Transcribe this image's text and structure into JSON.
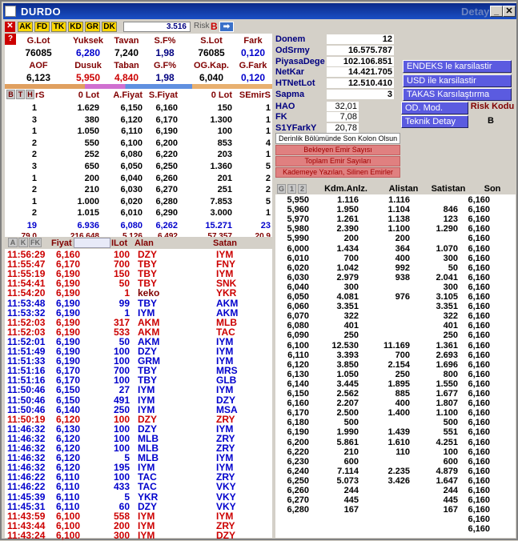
{
  "window": {
    "title": "DURDO",
    "detail": "Detay"
  },
  "toolbar": {
    "tabs": [
      "AK",
      "FD",
      "TK",
      "KD",
      "GR",
      "DK"
    ],
    "price": "3.516",
    "risk_label": "Risk",
    "risk_value": "B"
  },
  "summary": {
    "headers1": [
      "G.Lot",
      "Yuksek",
      "Tavan",
      "S.F%",
      "S.Lot",
      "Fark"
    ],
    "values1": [
      "76085",
      "6,280",
      "7,240",
      "1,98",
      "76085",
      "0,120"
    ],
    "headers2": [
      "AOF",
      "Dusuk",
      "Taban",
      "G.F%",
      "OG.Kap.",
      "G.Fark"
    ],
    "values2": [
      "6,123",
      "5,950",
      "4,840",
      "1,98",
      "6,040",
      "0,120"
    ]
  },
  "stats": [
    {
      "label": "Donem",
      "value": "12"
    },
    {
      "label": "OdSrmy",
      "value": "16.575.787"
    },
    {
      "label": "PiyasaDege",
      "value": "102.106.851"
    },
    {
      "label": "NetKar",
      "value": "14.421.705"
    },
    {
      "label": "HTNetLot",
      "value": "12.510.410"
    },
    {
      "label": "Sapma",
      "value": "3"
    }
  ],
  "stats2": [
    {
      "label": "HAO",
      "value": "32,01"
    },
    {
      "label": "FK",
      "value": "7,08"
    },
    {
      "label": "S1YFarkY",
      "value": "20,78"
    }
  ],
  "buttons": {
    "endeks": "ENDEKS le karsilastir",
    "usd": "USD ile karsilastir",
    "takas": "TAKAS Karsılaştırma",
    "od_mod": "OD. Mod.",
    "risk_kodu": "Risk Kodu",
    "teknik": "Teknik Detay",
    "risk_val": "B"
  },
  "depth_note": "Derinlik Bölümünde Son Kolon Olsun",
  "red_buttons": [
    "Bekleyen Emir Sayısı",
    "Toplam Emir Sayıları",
    "Kademeye Yazılan, Silinen Emirler"
  ],
  "depth": {
    "side_tabs": [
      "B",
      "T",
      "H"
    ],
    "headers": [
      "rS",
      "0 Lot",
      "A.Fiyat",
      "S.Fiyat",
      "0 Lot",
      "SEmirS"
    ],
    "rows": [
      [
        "1",
        "1.629",
        "6,150",
        "6,160",
        "150",
        "1"
      ],
      [
        "3",
        "380",
        "6,120",
        "6,170",
        "1.300",
        "1"
      ],
      [
        "1",
        "1.050",
        "6,110",
        "6,190",
        "100",
        "1"
      ],
      [
        "2",
        "550",
        "6,100",
        "6,200",
        "853",
        "4"
      ],
      [
        "2",
        "252",
        "6,080",
        "6,220",
        "203",
        "1"
      ],
      [
        "3",
        "650",
        "6,050",
        "6,250",
        "1.360",
        "5"
      ],
      [
        "1",
        "200",
        "6,040",
        "6,260",
        "201",
        "2"
      ],
      [
        "2",
        "210",
        "6,030",
        "6,270",
        "251",
        "2"
      ],
      [
        "1",
        "1.000",
        "6,020",
        "6,280",
        "7.853",
        "5"
      ],
      [
        "2",
        "1.015",
        "6,010",
        "6,290",
        "3.000",
        "1"
      ]
    ],
    "totals": [
      "19",
      "6.936",
      "6,080",
      "6,262",
      "15.271",
      "23"
    ],
    "extra": [
      "79.0",
      "216.648",
      "5.126",
      "6.492",
      "57.357",
      "20.9"
    ]
  },
  "trades": {
    "tabs": [
      "A",
      "K",
      "FK"
    ],
    "headers": [
      "Fiyat",
      "ILot",
      "Alan",
      "Satan"
    ],
    "rows": [
      {
        "t": "11:56:29",
        "p": "6,160",
        "l": "100",
        "a": "DZY",
        "s": "IYM",
        "c": "r"
      },
      {
        "t": "11:55:47",
        "p": "6,170",
        "l": "700",
        "a": "TBY",
        "s": "FNY",
        "c": "r"
      },
      {
        "t": "11:55:19",
        "p": "6,190",
        "l": "150",
        "a": "TBY",
        "s": "IYM",
        "c": "r"
      },
      {
        "t": "11:54:41",
        "p": "6,190",
        "l": "50",
        "a": "TBY",
        "s": "SNK",
        "c": "r"
      },
      {
        "t": "11:54:20",
        "p": "6,190",
        "l": "1",
        "a": "keko",
        "s": "YKR",
        "c": "r"
      },
      {
        "t": "11:53:48",
        "p": "6,190",
        "l": "99",
        "a": "TBY",
        "s": "AKM",
        "c": "b"
      },
      {
        "t": "11:53:32",
        "p": "6,190",
        "l": "1",
        "a": "IYM",
        "s": "AKM",
        "c": "b"
      },
      {
        "t": "11:52:03",
        "p": "6,190",
        "l": "317",
        "a": "AKM",
        "s": "MLB",
        "c": "r"
      },
      {
        "t": "11:52:03",
        "p": "6,190",
        "l": "533",
        "a": "AKM",
        "s": "TAC",
        "c": "r"
      },
      {
        "t": "11:52:01",
        "p": "6,190",
        "l": "50",
        "a": "AKM",
        "s": "IYM",
        "c": "b"
      },
      {
        "t": "11:51:49",
        "p": "6,190",
        "l": "100",
        "a": "DZY",
        "s": "IYM",
        "c": "b"
      },
      {
        "t": "11:51:33",
        "p": "6,190",
        "l": "100",
        "a": "GRM",
        "s": "IYM",
        "c": "b"
      },
      {
        "t": "11:51:16",
        "p": "6,170",
        "l": "700",
        "a": "TBY",
        "s": "MRS",
        "c": "b"
      },
      {
        "t": "11:51:16",
        "p": "6,170",
        "l": "100",
        "a": "TBY",
        "s": "GLB",
        "c": "b"
      },
      {
        "t": "11:50:46",
        "p": "6,150",
        "l": "27",
        "a": "IYM",
        "s": "IYM",
        "c": "b"
      },
      {
        "t": "11:50:46",
        "p": "6,150",
        "l": "491",
        "a": "IYM",
        "s": "DZY",
        "c": "b"
      },
      {
        "t": "11:50:46",
        "p": "6,140",
        "l": "250",
        "a": "IYM",
        "s": "MSA",
        "c": "b"
      },
      {
        "t": "11:50:19",
        "p": "6,120",
        "l": "100",
        "a": "DZY",
        "s": "ZRY",
        "c": "r"
      },
      {
        "t": "11:46:32",
        "p": "6,130",
        "l": "100",
        "a": "DZY",
        "s": "IYM",
        "c": "b"
      },
      {
        "t": "11:46:32",
        "p": "6,120",
        "l": "100",
        "a": "MLB",
        "s": "ZRY",
        "c": "b"
      },
      {
        "t": "11:46:32",
        "p": "6,120",
        "l": "100",
        "a": "MLB",
        "s": "ZRY",
        "c": "b"
      },
      {
        "t": "11:46:32",
        "p": "6,120",
        "l": "5",
        "a": "MLB",
        "s": "IYM",
        "c": "b"
      },
      {
        "t": "11:46:32",
        "p": "6,120",
        "l": "195",
        "a": "IYM",
        "s": "IYM",
        "c": "b"
      },
      {
        "t": "11:46:22",
        "p": "6,110",
        "l": "100",
        "a": "TAC",
        "s": "ZRY",
        "c": "b"
      },
      {
        "t": "11:46:22",
        "p": "6,110",
        "l": "433",
        "a": "TAC",
        "s": "VKY",
        "c": "b"
      },
      {
        "t": "11:45:39",
        "p": "6,110",
        "l": "5",
        "a": "YKR",
        "s": "VKY",
        "c": "b"
      },
      {
        "t": "11:45:31",
        "p": "6,110",
        "l": "60",
        "a": "DZY",
        "s": "VKY",
        "c": "b"
      },
      {
        "t": "11:43:59",
        "p": "6,100",
        "l": "558",
        "a": "IYM",
        "s": "IYM",
        "c": "r"
      },
      {
        "t": "11:43:44",
        "p": "6,100",
        "l": "200",
        "a": "IYM",
        "s": "ZRY",
        "c": "r"
      },
      {
        "t": "11:43:24",
        "p": "6,100",
        "l": "300",
        "a": "IYM",
        "s": "DZY",
        "c": "r"
      }
    ]
  },
  "analysis": {
    "tabs": [
      "G",
      "1",
      "2"
    ],
    "headers": [
      "Kdm.Anlz.",
      "Alistan",
      "Satistan",
      "Son"
    ],
    "rows": [
      [
        "5,950",
        "1.116",
        "1.116",
        "",
        "6,160"
      ],
      [
        "5,960",
        "1.950",
        "1.104",
        "846",
        "6,160"
      ],
      [
        "5,970",
        "1.261",
        "1.138",
        "123",
        "6,160"
      ],
      [
        "5,980",
        "2.390",
        "1.100",
        "1.290",
        "6,160"
      ],
      [
        "5,990",
        "200",
        "200",
        "",
        "6,160"
      ],
      [
        "6,000",
        "1.434",
        "364",
        "1.070",
        "6,160"
      ],
      [
        "6,010",
        "700",
        "400",
        "300",
        "6,160"
      ],
      [
        "6,020",
        "1.042",
        "992",
        "50",
        "6,160"
      ],
      [
        "6,030",
        "2.979",
        "938",
        "2.041",
        "6,160"
      ],
      [
        "6,040",
        "300",
        "",
        "300",
        "6,160"
      ],
      [
        "6,050",
        "4.081",
        "976",
        "3.105",
        "6,160"
      ],
      [
        "6,060",
        "3.351",
        "",
        "3.351",
        "6,160"
      ],
      [
        "6,070",
        "322",
        "",
        "322",
        "6,160"
      ],
      [
        "6,080",
        "401",
        "",
        "401",
        "6,160"
      ],
      [
        "6,090",
        "250",
        "",
        "250",
        "6,160"
      ],
      [
        "6,100",
        "12.530",
        "11.169",
        "1.361",
        "6,160"
      ],
      [
        "6,110",
        "3.393",
        "700",
        "2.693",
        "6,160"
      ],
      [
        "6,120",
        "3.850",
        "2.154",
        "1.696",
        "6,160"
      ],
      [
        "6,130",
        "1.050",
        "250",
        "800",
        "6,160"
      ],
      [
        "6,140",
        "3.445",
        "1.895",
        "1.550",
        "6,160"
      ],
      [
        "6,150",
        "2.562",
        "885",
        "1.677",
        "6,160"
      ],
      [
        "6,160",
        "2.207",
        "400",
        "1.807",
        "6,160"
      ],
      [
        "6,170",
        "2.500",
        "1.400",
        "1.100",
        "6,160"
      ],
      [
        "6,180",
        "500",
        "",
        "500",
        "6,160"
      ],
      [
        "6,190",
        "1.990",
        "1.439",
        "551",
        "6,160"
      ],
      [
        "6,200",
        "5.861",
        "1.610",
        "4.251",
        "6,160"
      ],
      [
        "6,220",
        "210",
        "110",
        "100",
        "6,160"
      ],
      [
        "6,230",
        "600",
        "",
        "600",
        "6,160"
      ],
      [
        "6,240",
        "7.114",
        "2.235",
        "4.879",
        "6,160"
      ],
      [
        "6,250",
        "5.073",
        "3.426",
        "1.647",
        "6,160"
      ],
      [
        "6,260",
        "244",
        "",
        "244",
        "6,160"
      ],
      [
        "6,270",
        "445",
        "",
        "445",
        "6,160"
      ],
      [
        "6,280",
        "167",
        "",
        "167",
        "6,160"
      ],
      [
        "",
        "",
        "",
        "",
        "6,160"
      ],
      [
        "",
        "",
        "",
        "",
        "6,160"
      ]
    ]
  },
  "colors": {
    "red": "#cc0000",
    "blue": "#0000cc",
    "navy": "#000080",
    "maroon": "#800000",
    "button": "#5b5be0"
  }
}
